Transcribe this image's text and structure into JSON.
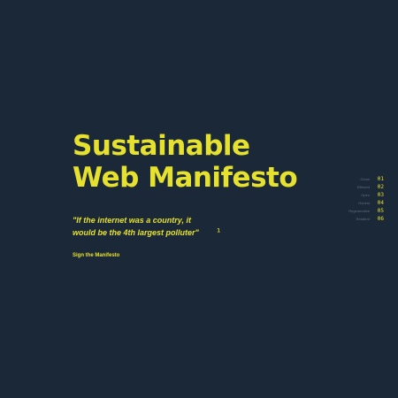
{
  "hero": {
    "title_line1": "Sustainable",
    "title_line2": "Web Manifesto",
    "quote": "\"If the internet was a country, it would be the 4th largest polluter\"",
    "footnote_marker": "¹",
    "cta_label": "Sign the Manifesto"
  },
  "nav": {
    "items": [
      {
        "label": "Clean",
        "number": "01"
      },
      {
        "label": "Efficient",
        "number": "02"
      },
      {
        "label": "Open",
        "number": "03"
      },
      {
        "label": "Honest",
        "number": "04"
      },
      {
        "label": "Regenerative",
        "number": "05"
      },
      {
        "label": "Resilient",
        "number": "06"
      }
    ]
  },
  "colors": {
    "background": "#1a2837",
    "accent": "#e6e12f",
    "muted": "#5e6d7d"
  }
}
